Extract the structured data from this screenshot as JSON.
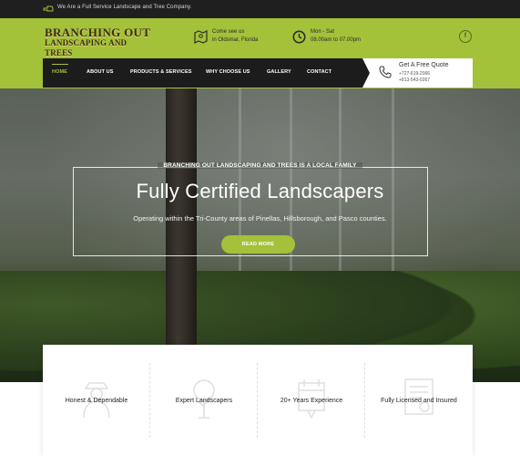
{
  "topbar": {
    "icon": "hand-point-icon",
    "text": "We Are a Full Service Landscape and Tree Company."
  },
  "brand": {
    "line1": "BRANCHING OUT",
    "line2": "LANDSCAPING AND TREES"
  },
  "location": {
    "icon": "map-icon",
    "line1": "Come see us",
    "line2": "in Oldsmar, Florida"
  },
  "hours": {
    "icon": "clock-icon",
    "line1": "Mon - Sat",
    "line2": "08.00am to 07.00pm"
  },
  "social": {
    "facebook_icon": "facebook-icon",
    "facebook_glyph": "f"
  },
  "nav": {
    "items": [
      {
        "label": "HOME",
        "active": true
      },
      {
        "label": "ABOUT US"
      },
      {
        "label": "PRODUCTS & SERVICES"
      },
      {
        "label": "WHY CHOOSE US"
      },
      {
        "label": "GALLERY"
      },
      {
        "label": "CONTACT"
      }
    ]
  },
  "quote": {
    "icon": "phone-icon",
    "title": "Get A Free Quote",
    "phone1": "+727-619-2066",
    "phone2": "+813-543-0267"
  },
  "hero": {
    "kicker": "BRANCHING OUT LANDSCAPING AND TREES IS A LOCAL FAMILY",
    "title": "Fully Certified Landscapers",
    "subtitle": "Operating within the Tri-County areas of Pinellas, Hillsborough, and Pasco counties.",
    "button": "READ MORE"
  },
  "features": [
    {
      "icon": "farmer-icon",
      "label": "Honest & Dependable"
    },
    {
      "icon": "tree-icon",
      "label": "Expert Landscapers"
    },
    {
      "icon": "calendar-icon",
      "label": "20+ Years Experience"
    },
    {
      "icon": "certificate-icon",
      "label": "Fully Licensed and Insured"
    }
  ],
  "colors": {
    "accent": "#a3c239",
    "dark": "#1c1c1c",
    "brand_text": "#3e2a14"
  }
}
